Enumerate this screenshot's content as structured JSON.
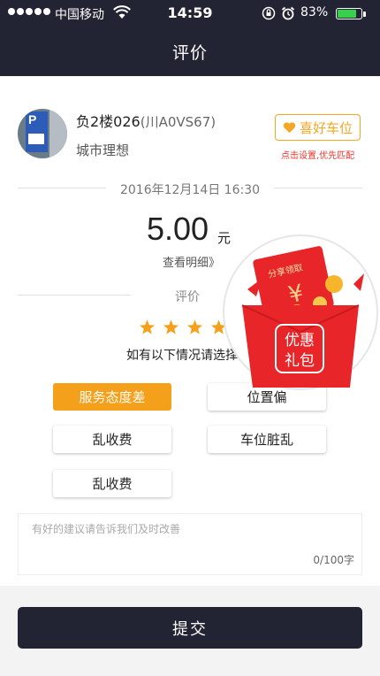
{
  "status_bar": {
    "carrier": "中国移动",
    "time": "14:59",
    "battery_percent": "83%",
    "battery_level": 0.83
  },
  "nav": {
    "title": "评价"
  },
  "parking": {
    "name": "负2楼026",
    "plate": "(川A0VS67)",
    "subtitle": "城市理想",
    "favorite_label": "喜好车位",
    "favorite_hint": "点击设置,优先匹配"
  },
  "order": {
    "date": "2016年12月14日 16:30",
    "amount": "5.00",
    "unit": "元",
    "detail_link": "查看明细》"
  },
  "rating": {
    "title": "评价",
    "stars_filled": 4,
    "hint": "如有以下情况请选择"
  },
  "tags": [
    {
      "label": "服务态度差",
      "selected": true
    },
    {
      "label": "位置偏",
      "selected": false
    },
    {
      "label": "乱收费",
      "selected": false
    },
    {
      "label": "车位脏乱",
      "selected": false
    },
    {
      "label": "乱收费",
      "selected": false
    }
  ],
  "comment": {
    "placeholder": "有好的建议请告诉我们及时改善",
    "counter": "0/100字"
  },
  "submit_label": "提交",
  "promo": {
    "envelope_text": "分享领取",
    "currency_symbol": "¥",
    "badge_line1": "优惠",
    "badge_line2": "礼包"
  },
  "colors": {
    "header": "#232433",
    "accent": "#f5a623",
    "hint_red": "#e8352a",
    "envelope_red": "#e8262a"
  },
  "icons": [
    "wifi-icon",
    "lock-rotation-icon",
    "alarm-icon",
    "battery-icon",
    "heart-icon",
    "star-icon",
    "red-envelope-icon"
  ]
}
